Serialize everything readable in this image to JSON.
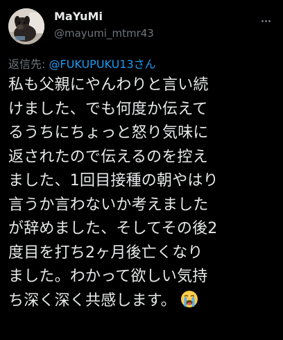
{
  "author": {
    "display_name": "MaYuMi",
    "handle": "@mayumi_mtmr43",
    "avatar_icon": "profile-photo-dog"
  },
  "more_icon": "more-options-icon",
  "reply_to": {
    "label": "返信先: ",
    "mention": "@FUKUPUKU13さん"
  },
  "body": {
    "lines": [
      "私も父親にやんわりと言い続",
      "けました、でも何度か伝えて",
      "るうちにちょっと怒り気味に",
      "返されたので伝えるのを控え",
      "ました、1回目接種の朝やはり",
      "言うか言わないか考えました",
      "が辞めました、そしてその後2",
      "度目を打ち2ヶ月後亡くなり",
      "ました。わかって欲しい気持",
      "ち深く深く共感します。"
    ],
    "trailing_emoji": "loudly-crying-face"
  },
  "colors": {
    "background": "#000000",
    "text_primary": "#e7e9ea",
    "text_secondary": "#71767b",
    "link": "#1d9bf0"
  }
}
